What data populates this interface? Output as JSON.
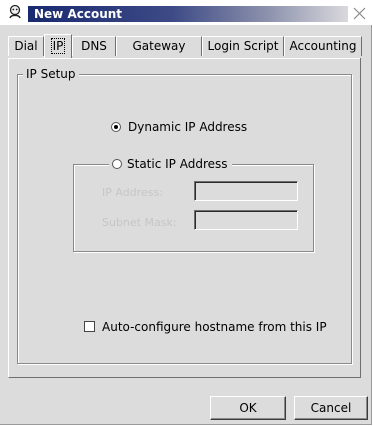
{
  "window": {
    "title": "New Account"
  },
  "tabs": [
    {
      "label": "Dial",
      "active": false
    },
    {
      "label": "IP",
      "active": true
    },
    {
      "label": "DNS",
      "active": false
    },
    {
      "label": "Gateway",
      "active": false
    },
    {
      "label": "Login Script",
      "active": false
    },
    {
      "label": "Accounting",
      "active": false
    }
  ],
  "ip_setup": {
    "group_label": "IP Setup",
    "dynamic_label": "Dynamic IP Address",
    "dynamic_selected": true,
    "static_label": "Static IP Address",
    "static_selected": false,
    "ip_address_label": "IP Address:",
    "ip_address_value": "",
    "subnet_mask_label": "Subnet Mask:",
    "subnet_mask_value": "",
    "autoconfig_label": "Auto-configure hostname from this IP",
    "autoconfig_checked": false
  },
  "buttons": {
    "ok": "OK",
    "cancel": "Cancel"
  },
  "colors": {
    "titlebar_start": "#1a2a70",
    "face": "#dcdcdc"
  }
}
